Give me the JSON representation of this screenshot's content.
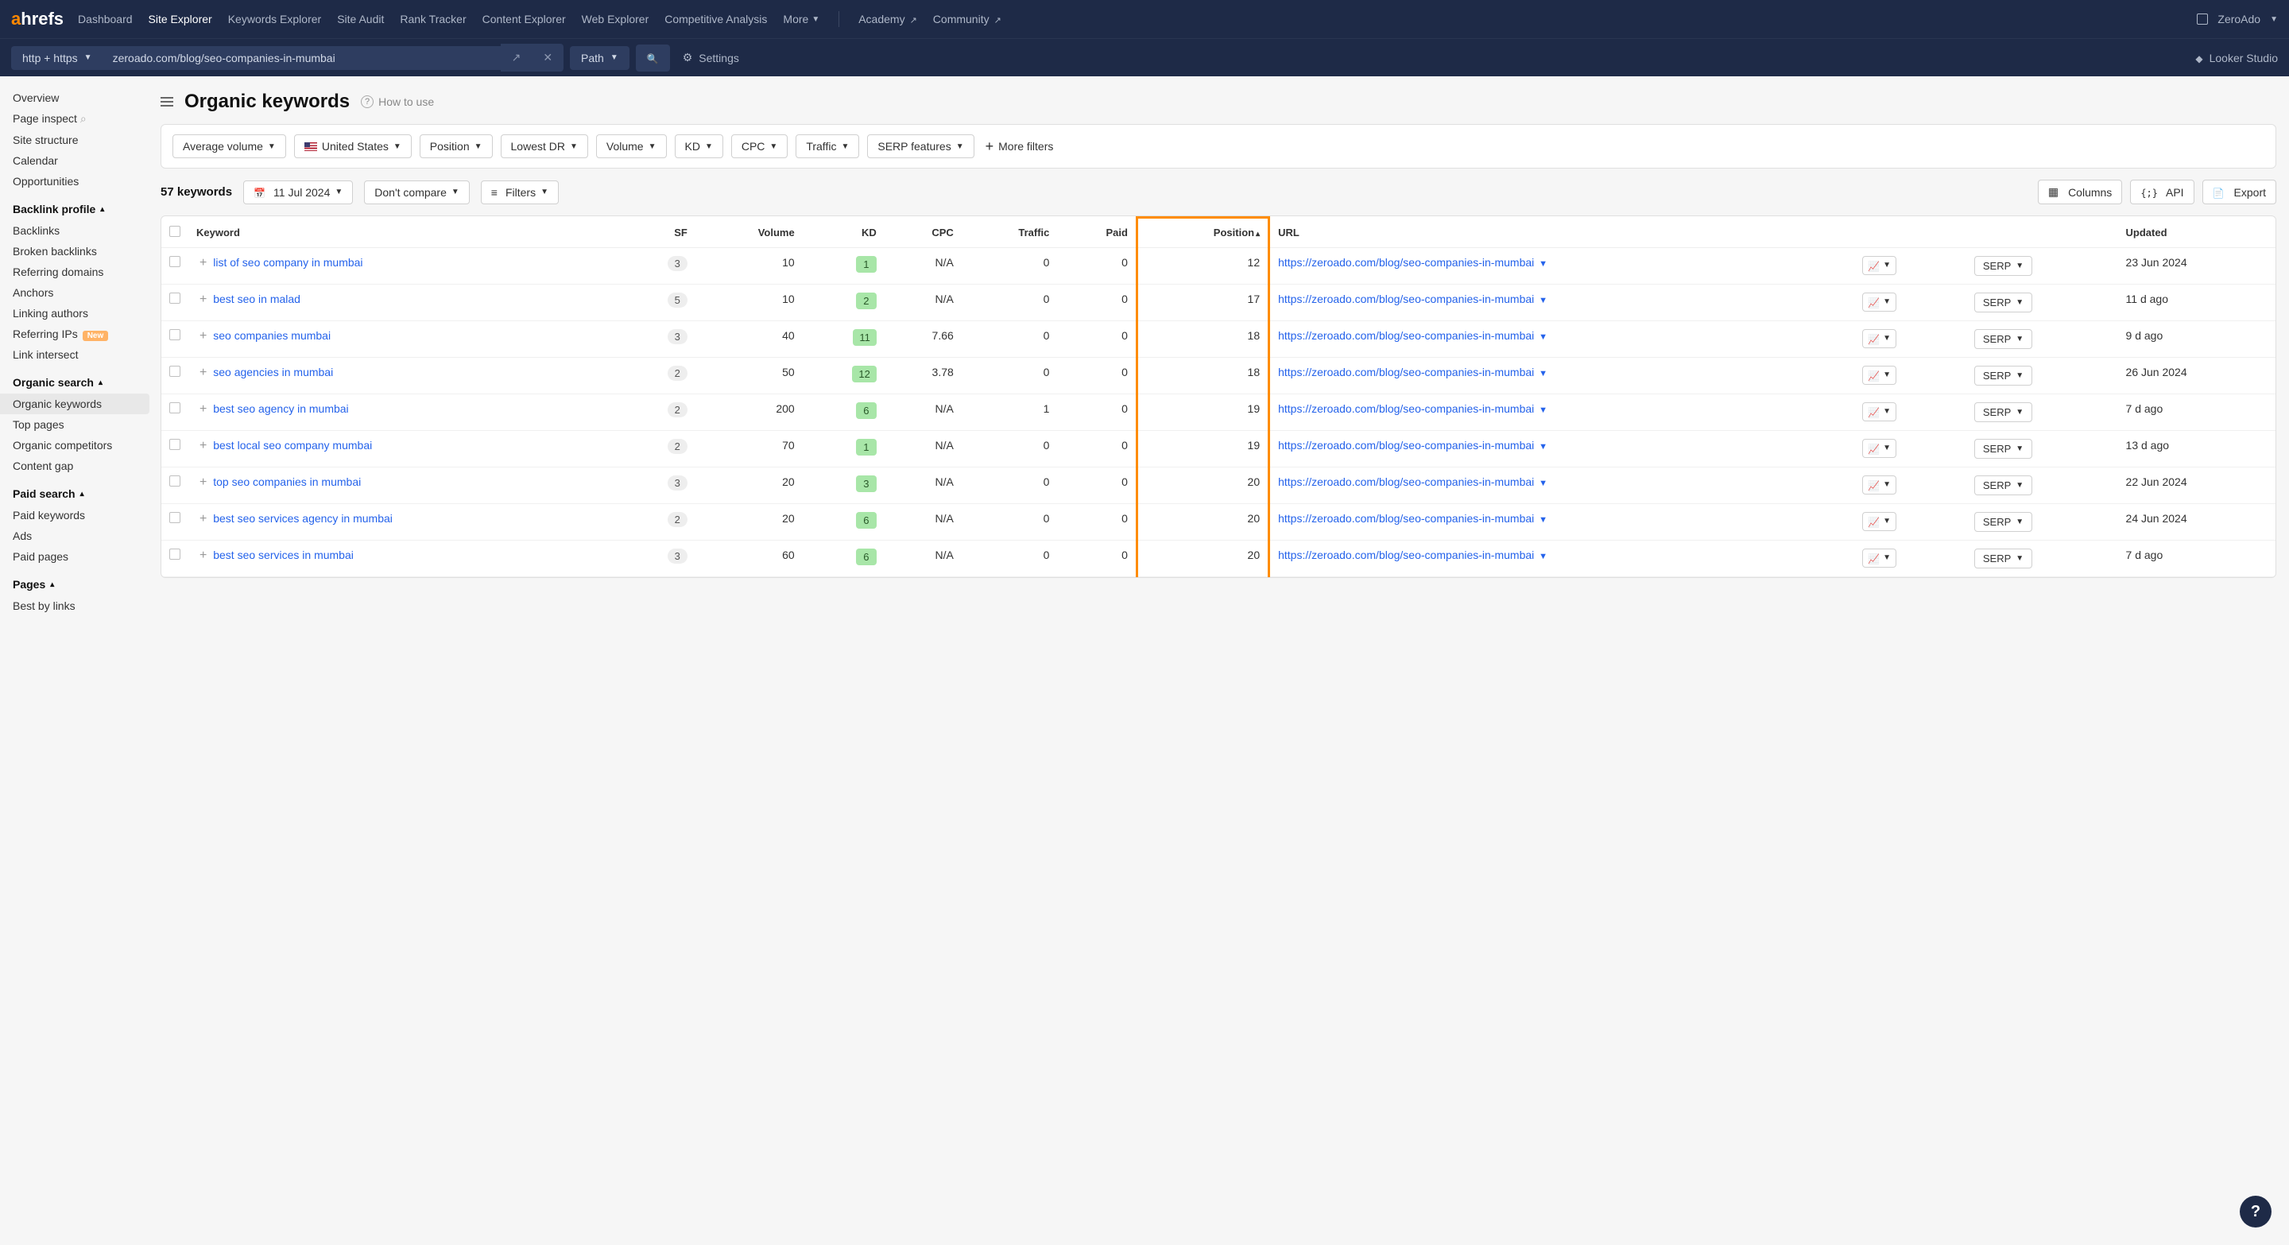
{
  "topnav": {
    "logo_a": "a",
    "logo_rest": "hrefs",
    "items": [
      "Dashboard",
      "Site Explorer",
      "Keywords Explorer",
      "Site Audit",
      "Rank Tracker",
      "Content Explorer",
      "Web Explorer",
      "Competitive Analysis",
      "More"
    ],
    "academy": "Academy",
    "community": "Community",
    "user": "ZeroAdo"
  },
  "secondbar": {
    "protocol": "http + https",
    "url": "zeroado.com/blog/seo-companies-in-mumbai",
    "mode": "Path",
    "settings": "Settings",
    "looker": "Looker Studio"
  },
  "sidebar": {
    "top": [
      "Overview",
      "Page inspect",
      "Site structure",
      "Calendar",
      "Opportunities"
    ],
    "backlink_heading": "Backlink profile",
    "backlink": [
      "Backlinks",
      "Broken backlinks",
      "Referring domains",
      "Anchors",
      "Linking authors",
      "Referring IPs",
      "Link intersect"
    ],
    "referring_ips_badge": "New",
    "organic_heading": "Organic search",
    "organic": [
      "Organic keywords",
      "Top pages",
      "Organic competitors",
      "Content gap"
    ],
    "paid_heading": "Paid search",
    "paid": [
      "Paid keywords",
      "Ads",
      "Paid pages"
    ],
    "pages_heading": "Pages",
    "pages": [
      "Best by links"
    ]
  },
  "page": {
    "title": "Organic keywords",
    "howto": "How to use"
  },
  "filters": [
    "Average volume",
    "United States",
    "Position",
    "Lowest DR",
    "Volume",
    "KD",
    "CPC",
    "Traffic",
    "SERP features"
  ],
  "more_filters": "More filters",
  "meta": {
    "count": "57 keywords",
    "date": "11 Jul 2024",
    "compare": "Don't compare",
    "filters_btn": "Filters",
    "columns": "Columns",
    "api": "API",
    "export": "Export"
  },
  "columns": [
    "Keyword",
    "SF",
    "Volume",
    "KD",
    "CPC",
    "Traffic",
    "Paid",
    "Position",
    "URL",
    "Updated"
  ],
  "serp_label": "SERP",
  "rows": [
    {
      "keyword": "list of seo company in mumbai",
      "sf": "3",
      "vol": "10",
      "kd": "1",
      "cpc": "N/A",
      "traffic": "0",
      "paid": "0",
      "pos": "12",
      "url": "https://zeroado.com/blog/seo-companies-in-mumbai",
      "updated": "23 Jun 2024"
    },
    {
      "keyword": "best seo in malad",
      "sf": "5",
      "vol": "10",
      "kd": "2",
      "cpc": "N/A",
      "traffic": "0",
      "paid": "0",
      "pos": "17",
      "url": "https://zeroado.com/blog/seo-companies-in-mumbai",
      "updated": "11 d ago"
    },
    {
      "keyword": "seo companies mumbai",
      "sf": "3",
      "vol": "40",
      "kd": "11",
      "cpc": "7.66",
      "traffic": "0",
      "paid": "0",
      "pos": "18",
      "url": "https://zeroado.com/blog/seo-companies-in-mumbai",
      "updated": "9 d ago"
    },
    {
      "keyword": "seo agencies in mumbai",
      "sf": "2",
      "vol": "50",
      "kd": "12",
      "cpc": "3.78",
      "traffic": "0",
      "paid": "0",
      "pos": "18",
      "url": "https://zeroado.com/blog/seo-companies-in-mumbai",
      "updated": "26 Jun 2024"
    },
    {
      "keyword": "best seo agency in mumbai",
      "sf": "2",
      "vol": "200",
      "kd": "6",
      "cpc": "N/A",
      "traffic": "1",
      "paid": "0",
      "pos": "19",
      "url": "https://zeroado.com/blog/seo-companies-in-mumbai",
      "updated": "7 d ago"
    },
    {
      "keyword": "best local seo company mumbai",
      "sf": "2",
      "vol": "70",
      "kd": "1",
      "cpc": "N/A",
      "traffic": "0",
      "paid": "0",
      "pos": "19",
      "url": "https://zeroado.com/blog/seo-companies-in-mumbai",
      "updated": "13 d ago"
    },
    {
      "keyword": "top seo companies in mumbai",
      "sf": "3",
      "vol": "20",
      "kd": "3",
      "cpc": "N/A",
      "traffic": "0",
      "paid": "0",
      "pos": "20",
      "url": "https://zeroado.com/blog/seo-companies-in-mumbai",
      "updated": "22 Jun 2024"
    },
    {
      "keyword": "best seo services agency in mumbai",
      "sf": "2",
      "vol": "20",
      "kd": "6",
      "cpc": "N/A",
      "traffic": "0",
      "paid": "0",
      "pos": "20",
      "url": "https://zeroado.com/blog/seo-companies-in-mumbai",
      "updated": "24 Jun 2024"
    },
    {
      "keyword": "best seo services in mumbai",
      "sf": "3",
      "vol": "60",
      "kd": "6",
      "cpc": "N/A",
      "traffic": "0",
      "paid": "0",
      "pos": "20",
      "url": "https://zeroado.com/blog/seo-companies-in-mumbai",
      "updated": "7 d ago"
    }
  ]
}
